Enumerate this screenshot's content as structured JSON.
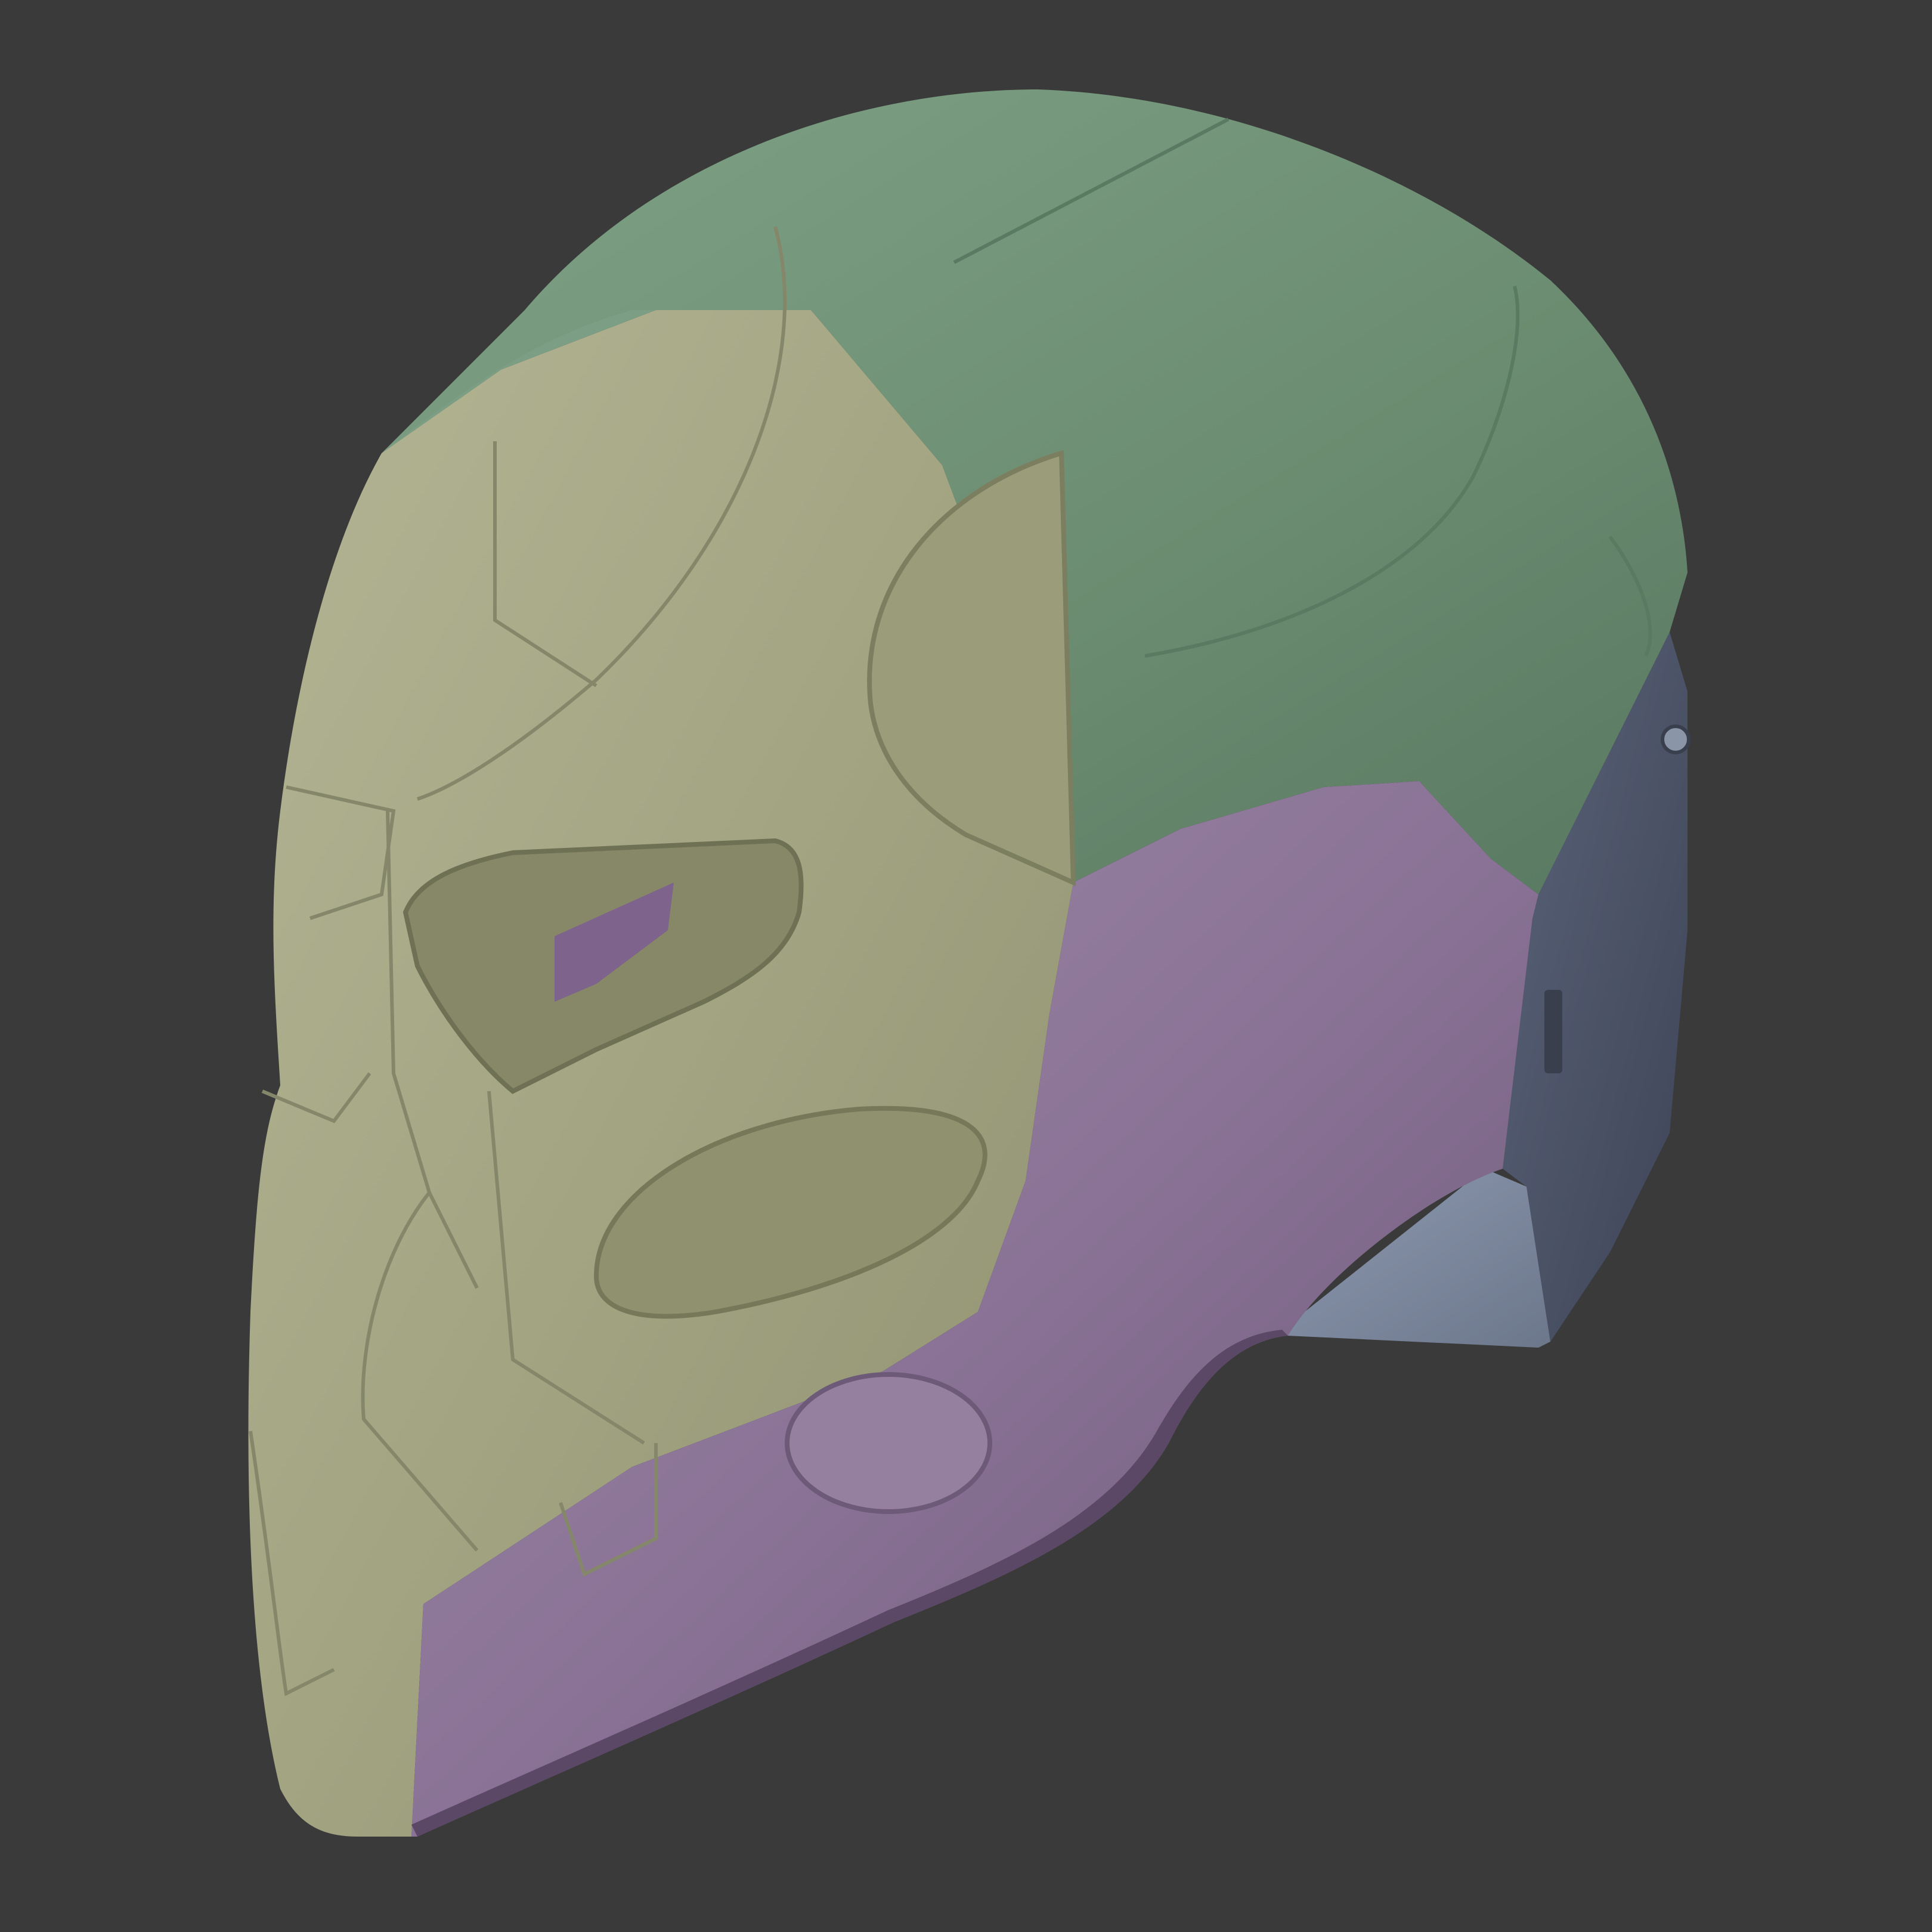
{
  "scene": {
    "background": "#3a3a3a",
    "subject": "helmet-3d-render",
    "parts": [
      {
        "name": "helmet-crown-shell",
        "color": "#6d8e72"
      },
      {
        "name": "helmet-face-plate",
        "color": "#a3a582"
      },
      {
        "name": "helmet-jaw-guard",
        "color": "#8a7396"
      },
      {
        "name": "helmet-rear-neck-plate",
        "color": "#4d5568"
      },
      {
        "name": "helmet-lower-neck-plate",
        "color": "#7a869a"
      }
    ]
  }
}
